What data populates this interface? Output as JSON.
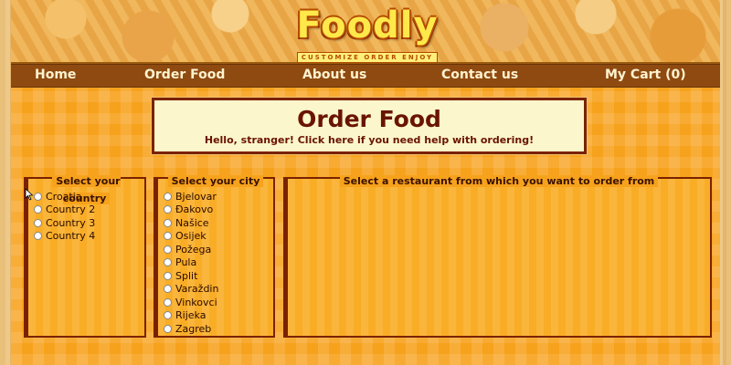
{
  "header": {
    "logo_text": "Foodly",
    "logo_tagline": "CUSTOMIZE ORDER ENJOY"
  },
  "nav": {
    "items": [
      {
        "label": "Home"
      },
      {
        "label": "Order Food"
      },
      {
        "label": "About us"
      },
      {
        "label": "Contact us"
      },
      {
        "label": "My Cart (0)"
      }
    ]
  },
  "main": {
    "title": "Order Food",
    "subtitle": "Hello, stranger! Click here if you need help with ordering!"
  },
  "country_panel": {
    "legend": "Select your country",
    "options": [
      "Croatia",
      "Country 2",
      "Country 3",
      "Country 4"
    ]
  },
  "city_panel": {
    "legend": "Select your city",
    "options": [
      "Bjelovar",
      "Đakovo",
      "Našice",
      "Osijek",
      "Požega",
      "Pula",
      "Split",
      "Varaždin",
      "Vinkovci",
      "Rijeka",
      "Zagreb"
    ]
  },
  "restaurant_panel": {
    "legend": "Select a restaurant from which you want to order from"
  },
  "colors": {
    "accent": "#7a2200",
    "nav_bg": "#8e4a10",
    "page_bg": "#f7a21c",
    "title_box_bg": "#fbf6cc"
  }
}
